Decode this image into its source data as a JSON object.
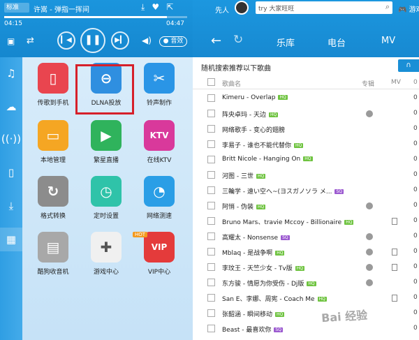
{
  "player": {
    "mode": "标准",
    "now_playing": "许嵩 - 弹指一挥间",
    "time_current": "04:15",
    "time_total": "04:47",
    "progress": 0.89,
    "sound_effect": "音效",
    "icons": {
      "download": "download-icon",
      "favorite": "heart-icon",
      "share": "share-icon",
      "lyric": "lyric-icon",
      "shuffle": "shuffle-icon",
      "prev": "prev-icon",
      "pause": "pause-icon",
      "next": "next-icon",
      "volume": "volume-icon"
    }
  },
  "header": {
    "user_name": "先人",
    "search_value": "try 大家旺旺",
    "game_link": "游戏",
    "tabs": [
      "乐库",
      "电台",
      "MV"
    ]
  },
  "sidebar": {
    "icons": [
      "music-note-icon",
      "cloud-icon",
      "wireless-icon",
      "device-icon",
      "download-icon",
      "apps-grid-icon"
    ]
  },
  "apps": [
    {
      "label": "传歌到手机",
      "color": "#e9454f",
      "glyph": "▯"
    },
    {
      "label": "DLNA投放",
      "color": "#2f8fe0",
      "glyph": "⊖"
    },
    {
      "label": "铃声制作",
      "color": "#2a95e6",
      "glyph": "✂"
    },
    {
      "label": "本地管理",
      "color": "#f5a623",
      "glyph": "▭"
    },
    {
      "label": "繁星直播",
      "color": "#2fb35c",
      "glyph": "▶"
    },
    {
      "label": "在线KTV",
      "color": "#d9399b",
      "glyph": "KTV"
    },
    {
      "label": "格式转换",
      "color": "#8c8c8c",
      "glyph": "↻"
    },
    {
      "label": "定时设置",
      "color": "#2fc3a9",
      "glyph": "◷"
    },
    {
      "label": "网络测速",
      "color": "#2a9ee6",
      "glyph": "◔"
    },
    {
      "label": "酷狗收音机",
      "color": "#a8a8a8",
      "glyph": "▤"
    },
    {
      "label": "游戏中心",
      "color": "#f0f0f0",
      "glyph": "✚"
    },
    {
      "label": "VIP中心",
      "color": "#e43b3b",
      "glyph": "VIP"
    }
  ],
  "hot_badge": "HOT",
  "song_list": {
    "title": "随机搜索推荐以下歌曲",
    "columns": {
      "title": "歌曲名",
      "album": "专辑",
      "mv": "MV",
      "duration": "0"
    },
    "songs": [
      {
        "title": "Kimeru - Overlap",
        "badge": "HQ",
        "badge_color": "#6ec33f",
        "album": false,
        "mv": false,
        "duration": "0"
      },
      {
        "title": "阵央卓玛 - 天边",
        "badge": "HQ",
        "badge_color": "#6ec33f",
        "album": true,
        "mv": false,
        "duration": "0"
      },
      {
        "title": "网络歌手 - 变心的翅膀",
        "badge": "",
        "badge_color": "",
        "album": false,
        "mv": false,
        "duration": "0"
      },
      {
        "title": "李易子 - 谁也不能代替你",
        "badge": "HQ",
        "badge_color": "#6ec33f",
        "album": false,
        "mv": false,
        "duration": "0"
      },
      {
        "title": "Britt Nicole - Hanging On",
        "badge": "HQ",
        "badge_color": "#6ec33f",
        "album": false,
        "mv": false,
        "duration": "0"
      },
      {
        "title": "河图 - 三世",
        "badge": "HQ",
        "badge_color": "#6ec33f",
        "album": false,
        "mv": false,
        "duration": "0"
      },
      {
        "title": "三輪学 - 遠い空へ~(ヨスガノソラ メ...",
        "badge": "SQ",
        "badge_color": "#9b59d0",
        "album": false,
        "mv": false,
        "duration": "0"
      },
      {
        "title": "阿悄 - 伪装",
        "badge": "HQ",
        "badge_color": "#6ec33f",
        "album": true,
        "mv": false,
        "duration": "0"
      },
      {
        "title": "Bruno Mars、travie Mccoy - Billionaire",
        "badge": "HQ",
        "badge_color": "#6ec33f",
        "album": false,
        "mv": true,
        "duration": "0"
      },
      {
        "title": "高耀太 - Nonsense",
        "badge": "SQ",
        "badge_color": "#9b59d0",
        "album": true,
        "mv": false,
        "duration": "0"
      },
      {
        "title": "Mblaq - 是战争啊",
        "badge": "HQ",
        "badge_color": "#6ec33f",
        "album": true,
        "mv": true,
        "duration": "0"
      },
      {
        "title": "李玟王 - 天竺少女 - Tv版",
        "badge": "HQ",
        "badge_color": "#6ec33f",
        "album": true,
        "mv": true,
        "duration": "0"
      },
      {
        "title": "东方骏 - 情愿为你受伤 - Dj版",
        "badge": "HQ",
        "badge_color": "#6ec33f",
        "album": true,
        "mv": false,
        "duration": "0"
      },
      {
        "title": "San E、李娜、周宪 - Coach Me",
        "badge": "HQ",
        "badge_color": "#6ec33f",
        "album": false,
        "mv": true,
        "duration": "0"
      },
      {
        "title": "张韶涵 - 瞬间移动",
        "badge": "HQ",
        "badge_color": "#6ec33f",
        "album": false,
        "mv": false,
        "duration": "0"
      },
      {
        "title": "Beast - 最喜欢你",
        "badge": "SQ",
        "badge_color": "#9b59d0",
        "album": false,
        "mv": false,
        "duration": "0"
      }
    ]
  },
  "watermark": "Bai 经验"
}
